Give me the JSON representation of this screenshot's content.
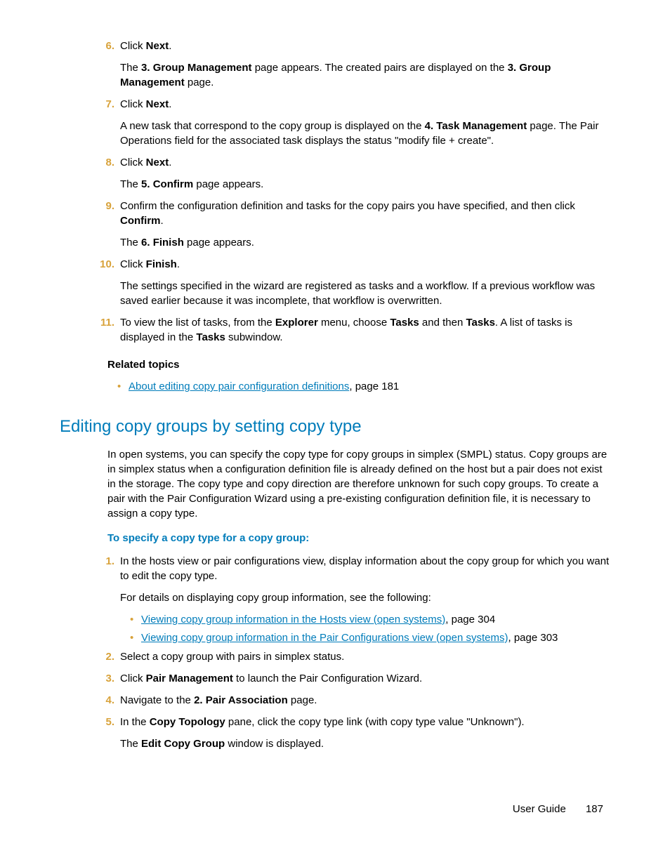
{
  "steps_a": {
    "6": {
      "num": "6.",
      "p1_pre": "Click ",
      "p1_b": "Next",
      "p1_post": ".",
      "p2_pre": "The ",
      "p2_b1": "3. Group Management",
      "p2_mid": " page appears. The created pairs are displayed on the ",
      "p2_b2": "3. Group Management",
      "p2_post": " page."
    },
    "7": {
      "num": "7.",
      "p1_pre": "Click ",
      "p1_b": "Next",
      "p1_post": ".",
      "p2_pre": "A new task that correspond to the copy group is displayed on the ",
      "p2_b": "4. Task Management",
      "p2_post": " page. The Pair Operations field for the associated task displays the status \"modify file + create\"."
    },
    "8": {
      "num": "8.",
      "p1_pre": "Click ",
      "p1_b": "Next",
      "p1_post": ".",
      "p2_pre": "The ",
      "p2_b": "5. Confirm",
      "p2_post": " page appears."
    },
    "9": {
      "num": "9.",
      "p1_pre": "Confirm the configuration definition and tasks for the copy pairs you have specified, and then click ",
      "p1_b": "Confirm",
      "p1_post": ".",
      "p2_pre": "The ",
      "p2_b": "6. Finish",
      "p2_post": " page appears."
    },
    "10": {
      "num": "10.",
      "p1_pre": "Click ",
      "p1_b": "Finish",
      "p1_post": ".",
      "p2": "The settings specified in the wizard are registered as tasks and a workflow. If a previous workflow was saved earlier because it was incomplete, that workflow is overwritten."
    },
    "11": {
      "num": "11.",
      "p1_pre": "To view the list of tasks, from the ",
      "p1_b1": "Explorer",
      "p1_mid1": " menu, choose ",
      "p1_b2": "Tasks",
      "p1_mid2": " and then ",
      "p1_b3": "Tasks",
      "p1_mid3": ". A list of tasks is displayed in the ",
      "p1_b4": "Tasks",
      "p1_post": " subwindow."
    }
  },
  "related": {
    "heading": "Related topics",
    "link1": "About editing copy pair configuration definitions",
    "link1_post": ", page 181"
  },
  "section": {
    "title": "Editing copy groups by setting copy type",
    "intro": "In open systems, you can specify the copy type for copy groups in simplex (SMPL) status. Copy groups are in simplex status when a configuration definition file is already defined on the host but a pair does not exist in the storage.  The copy type and copy direction are therefore unknown for such copy groups. To create a pair with the Pair Configuration Wizard using a pre-existing configuration definition file, it is necessary to assign a copy type.",
    "subhead": "To specify a copy type for a copy group:"
  },
  "steps_b": {
    "1": {
      "num": "1.",
      "p1": "In the hosts view or pair configurations view, display information about the copy group for which you want to edit the copy type.",
      "p2": "For details on displaying copy group information, see the following:",
      "bullet1_link": "Viewing copy group information in the Hosts view (open systems)",
      "bullet1_post": ", page 304",
      "bullet2_link": "Viewing copy group information in the Pair Configurations view (open systems)",
      "bullet2_post": ", page 303"
    },
    "2": {
      "num": "2.",
      "p1": "Select a copy group with pairs in simplex status."
    },
    "3": {
      "num": "3.",
      "p1_pre": "Click ",
      "p1_b": "Pair Management",
      "p1_post": " to launch the Pair Configuration Wizard."
    },
    "4": {
      "num": "4.",
      "p1_pre": "Navigate to the ",
      "p1_b": "2. Pair Association",
      "p1_post": " page."
    },
    "5": {
      "num": "5.",
      "p1_pre": "In the ",
      "p1_b": "Copy Topology",
      "p1_post": " pane, click the copy type link (with copy type value \"Unknown\").",
      "p2_pre": "The ",
      "p2_b": "Edit Copy Group",
      "p2_post": " window is displayed."
    }
  },
  "footer": {
    "label": "User Guide",
    "page": "187"
  }
}
